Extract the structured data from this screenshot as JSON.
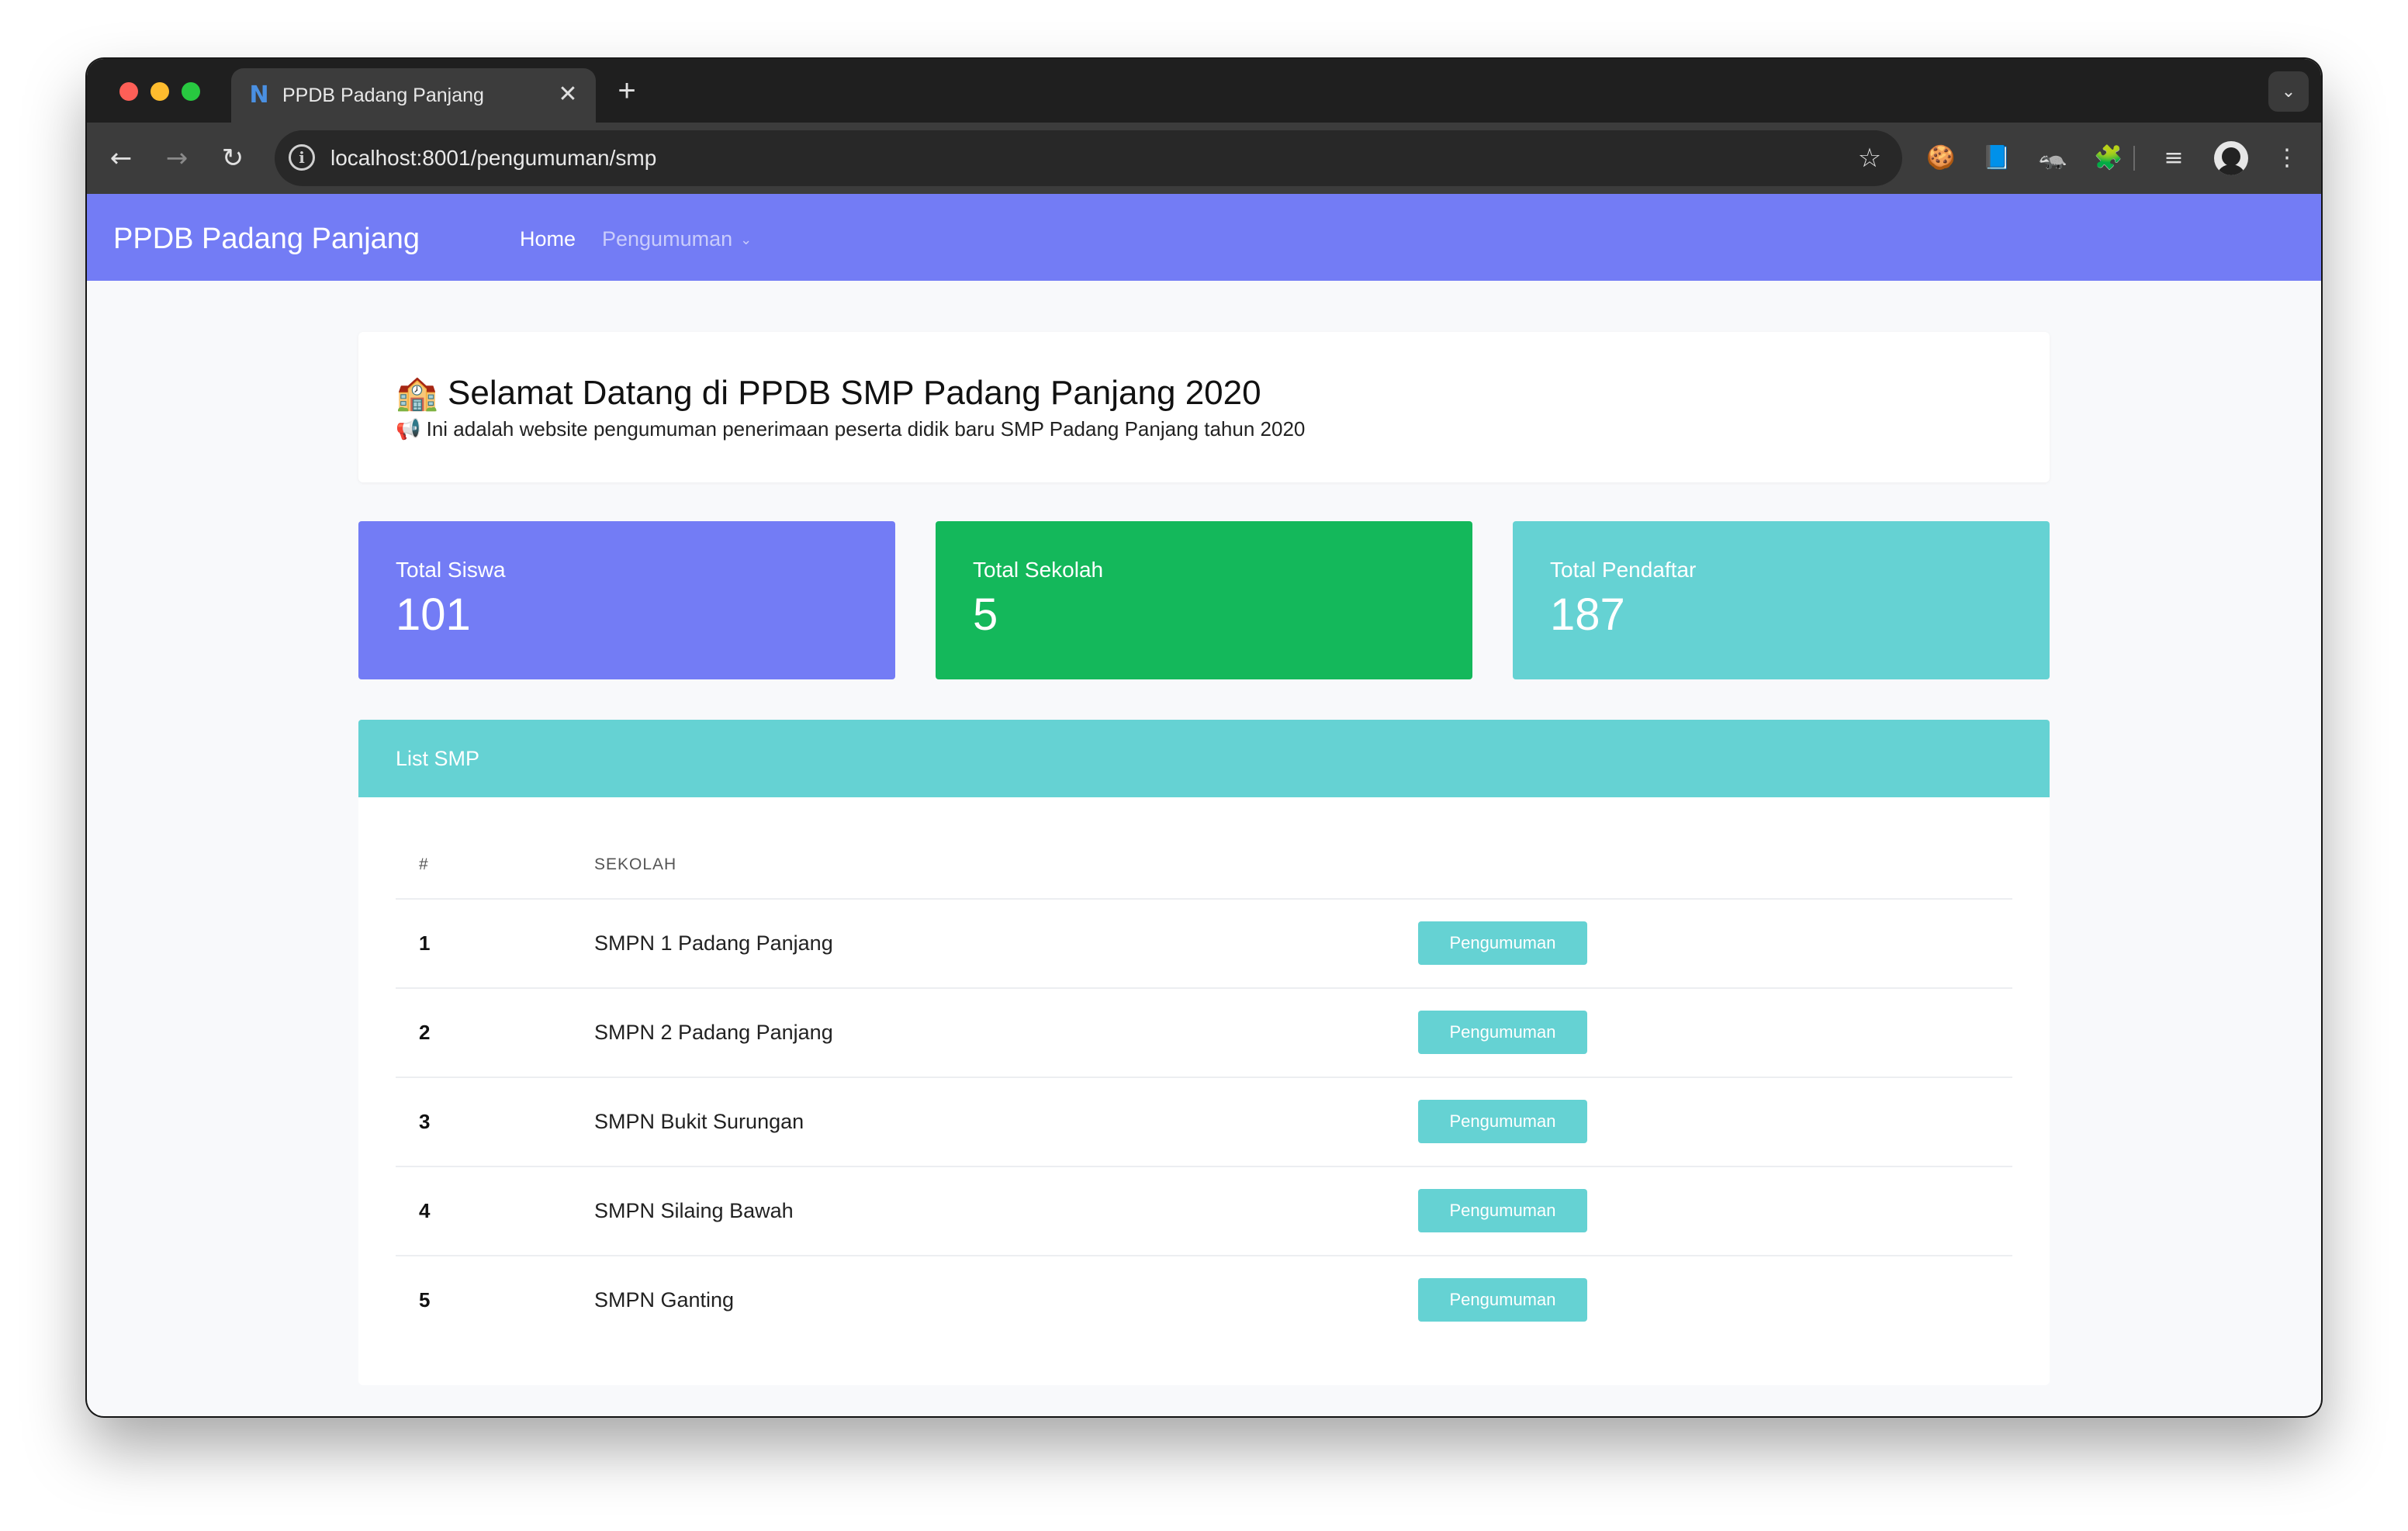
{
  "browser": {
    "tab_title": "PPDB Padang Panjang",
    "tab_favicon": "N",
    "tab_close": "✕",
    "new_tab": "+",
    "tab_dropdown": "⌄",
    "url": "localhost:8001/pengumuman/smp",
    "back": "←",
    "forward": "→",
    "reload": "↻",
    "info": "i",
    "star": "☆",
    "menu": "⋮",
    "extensions": [
      "🍪",
      "📘",
      "🦡",
      "🧩"
    ],
    "media": "≡"
  },
  "navbar": {
    "brand": "PPDB Padang Panjang",
    "home": "Home",
    "pengumuman": "Pengumuman",
    "caret": "⌄",
    "color": "#737cf5"
  },
  "welcome": {
    "icon": "🏫",
    "title": "Selamat Datang di PPDB SMP Padang Panjang 2020",
    "sub_icon": "📢",
    "subtitle": "Ini adalah website pengumuman penerimaan peserta didik baru SMP Padang Panjang tahun 2020"
  },
  "stats": [
    {
      "label": "Total Siswa",
      "value": "101",
      "color": "#737cf5"
    },
    {
      "label": "Total Sekolah",
      "value": "5",
      "color": "#14b85b"
    },
    {
      "label": "Total Pendaftar",
      "value": "187",
      "color": "#65d2d3"
    }
  ],
  "list": {
    "title": "List SMP",
    "headers": [
      "#",
      "SEKOLAH"
    ],
    "button_label": "Pengumuman",
    "rows": [
      {
        "num": "1",
        "name": "SMPN 1 Padang Panjang"
      },
      {
        "num": "2",
        "name": "SMPN 2 Padang Panjang"
      },
      {
        "num": "3",
        "name": "SMPN Bukit Surungan"
      },
      {
        "num": "4",
        "name": "SMPN Silaing Bawah"
      },
      {
        "num": "5",
        "name": "SMPN Ganting"
      }
    ]
  }
}
